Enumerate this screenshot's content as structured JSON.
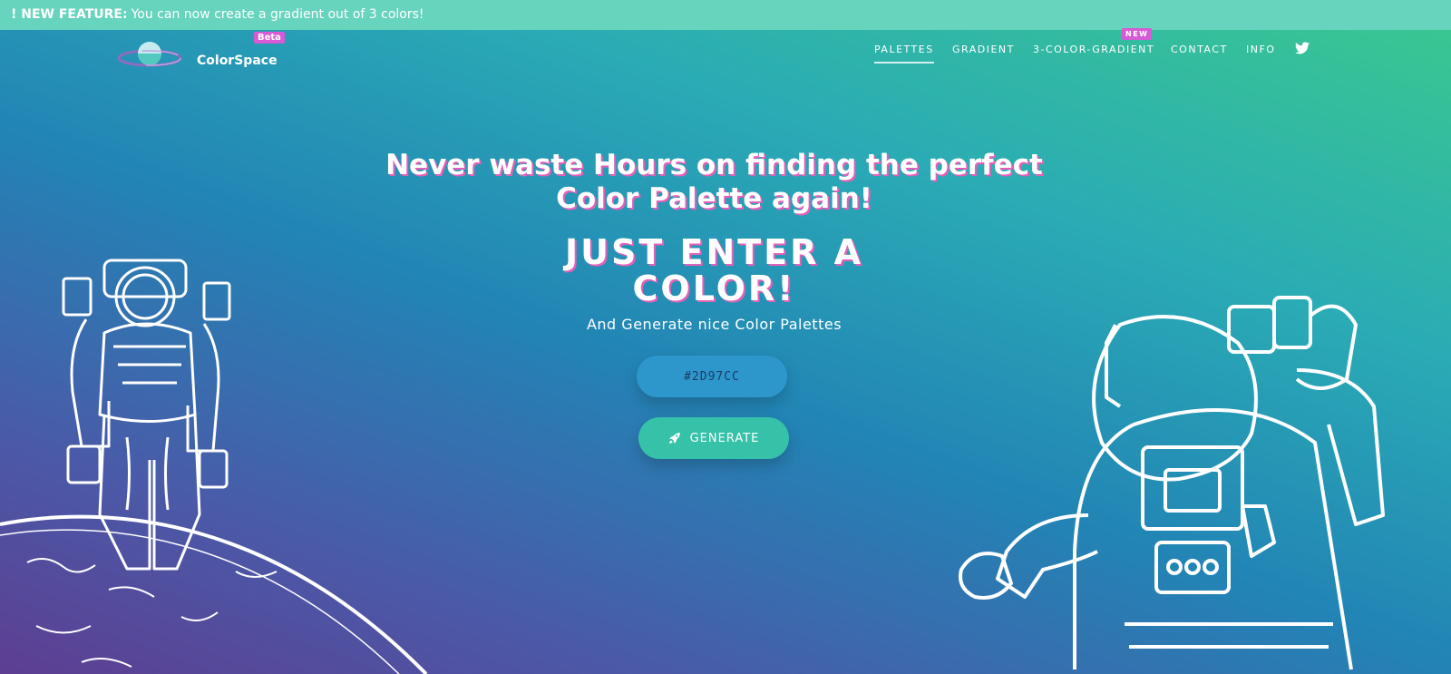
{
  "announcement": {
    "prefix": "! NEW FEATURE:",
    "text": "You can now create a gradient out of 3 colors!"
  },
  "brand": {
    "name": "ColorSpace",
    "badge": "Beta"
  },
  "nav": {
    "items": [
      {
        "label": "PALETTES",
        "active": true
      },
      {
        "label": "GRADIENT"
      },
      {
        "label": "3-COLOR-GRADIENT",
        "badge": "NEW"
      },
      {
        "label": "CONTACT"
      },
      {
        "label": "INFO"
      }
    ],
    "twitter_icon": "twitter-icon"
  },
  "hero": {
    "title_line1": "Never waste Hours on finding the perfect",
    "title_line2": "Color Palette again!",
    "subtitle_line1": "JUST ENTER A",
    "subtitle_line2": "COLOR!",
    "tagline": "And Generate nice Color Palettes"
  },
  "input": {
    "value": "#2D97CC",
    "color": "#2d97cc"
  },
  "generate_button": {
    "label": "GENERATE",
    "icon": "rocket-icon"
  },
  "colors": {
    "announce_bar": "#67d4bd",
    "badge": "#d85ad6",
    "generate": "#35c2a8",
    "text_shadow": "#e361b9"
  }
}
